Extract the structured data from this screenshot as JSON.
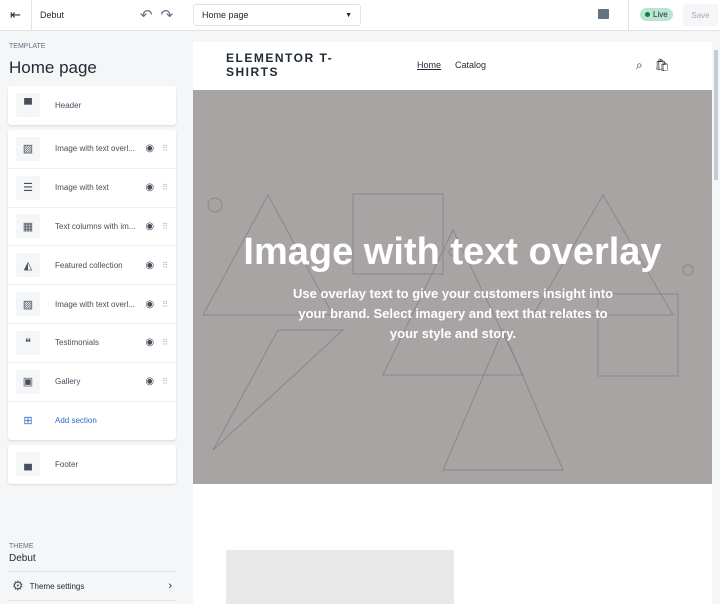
{
  "topbar": {
    "theme": "Debut",
    "page_select": "Home page",
    "live": "Live",
    "save": "Save"
  },
  "sidebar": {
    "template_label": "TEMPLATE",
    "title": "Home page",
    "header": "Header",
    "sections": [
      {
        "label": "Image with text overl...",
        "icon": "image-overlay-icon"
      },
      {
        "label": "Image with text",
        "icon": "image-text-icon"
      },
      {
        "label": "Text columns with im...",
        "icon": "text-columns-icon"
      },
      {
        "label": "Featured collection",
        "icon": "tag-icon"
      },
      {
        "label": "Image with text overl...",
        "icon": "image-overlay-icon"
      },
      {
        "label": "Testimonials",
        "icon": "quote-icon"
      },
      {
        "label": "Gallery",
        "icon": "gallery-icon"
      }
    ],
    "add_section": "Add section",
    "footer": "Footer",
    "theme_label": "THEME",
    "theme_name": "Debut",
    "theme_settings": "Theme settings"
  },
  "preview": {
    "logo": "ELEMENTOR T-SHIRTS",
    "nav": [
      "Home",
      "Catalog"
    ],
    "hero_title": "Image with text overlay",
    "hero_text": "Use overlay text to give your customers insight into your brand. Select imagery and text that relates to your style and story."
  }
}
